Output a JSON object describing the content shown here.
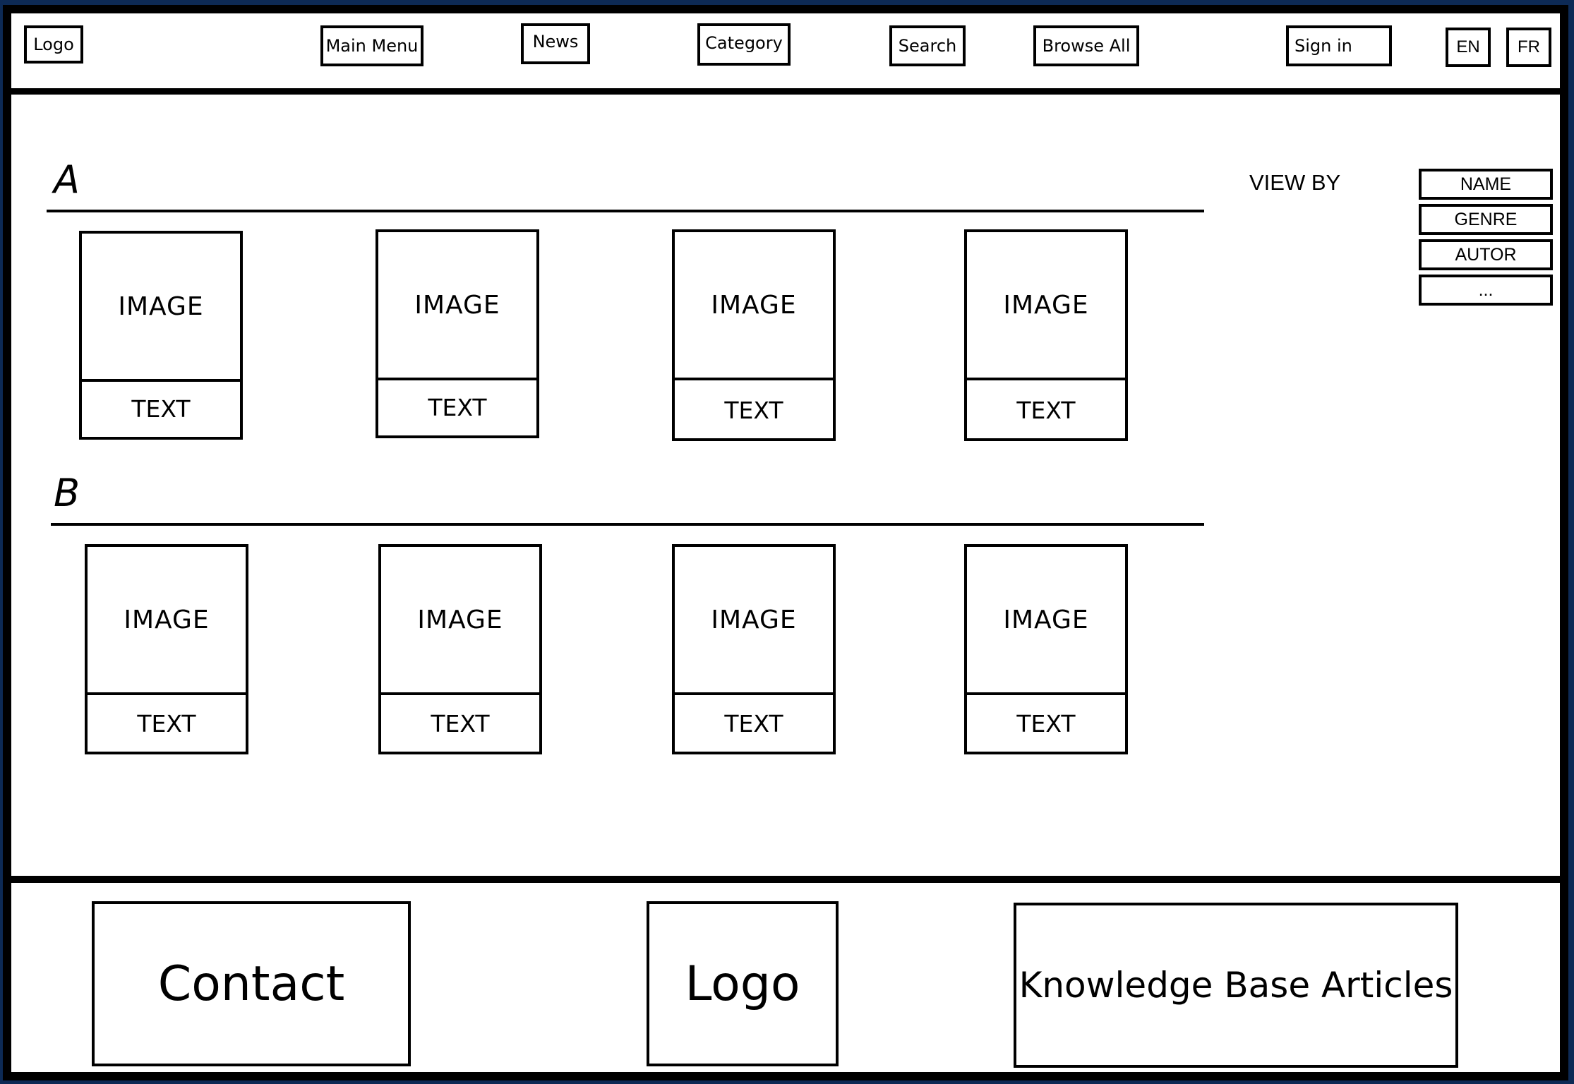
{
  "header": {
    "logo": "Logo",
    "nav": [
      "Main Menu",
      "News",
      "Category",
      "Search",
      "Browse All"
    ],
    "sign_in": "Sign in",
    "lang_en": "EN",
    "lang_fr": "FR"
  },
  "sections": [
    {
      "letter": "A",
      "cards": [
        {
          "image": "IMAGE",
          "text": "TEXT"
        },
        {
          "image": "IMAGE",
          "text": "TEXT"
        },
        {
          "image": "IMAGE",
          "text": "TEXT"
        },
        {
          "image": "IMAGE",
          "text": "TEXT"
        }
      ]
    },
    {
      "letter": "B",
      "cards": [
        {
          "image": "IMAGE",
          "text": "TEXT"
        },
        {
          "image": "IMAGE",
          "text": "TEXT"
        },
        {
          "image": "IMAGE",
          "text": "TEXT"
        },
        {
          "image": "IMAGE",
          "text": "TEXT"
        }
      ]
    }
  ],
  "view_by": {
    "label": "VIEW BY",
    "options": [
      "NAME",
      "GENRE",
      "AUTOR",
      "..."
    ]
  },
  "footer": {
    "contact": "Contact",
    "logo": "Logo",
    "kb": "Knowledge Base Articles"
  },
  "colors": {
    "outer_border": "#0d2a55",
    "ink": "#000000",
    "paper": "#ffffff"
  }
}
